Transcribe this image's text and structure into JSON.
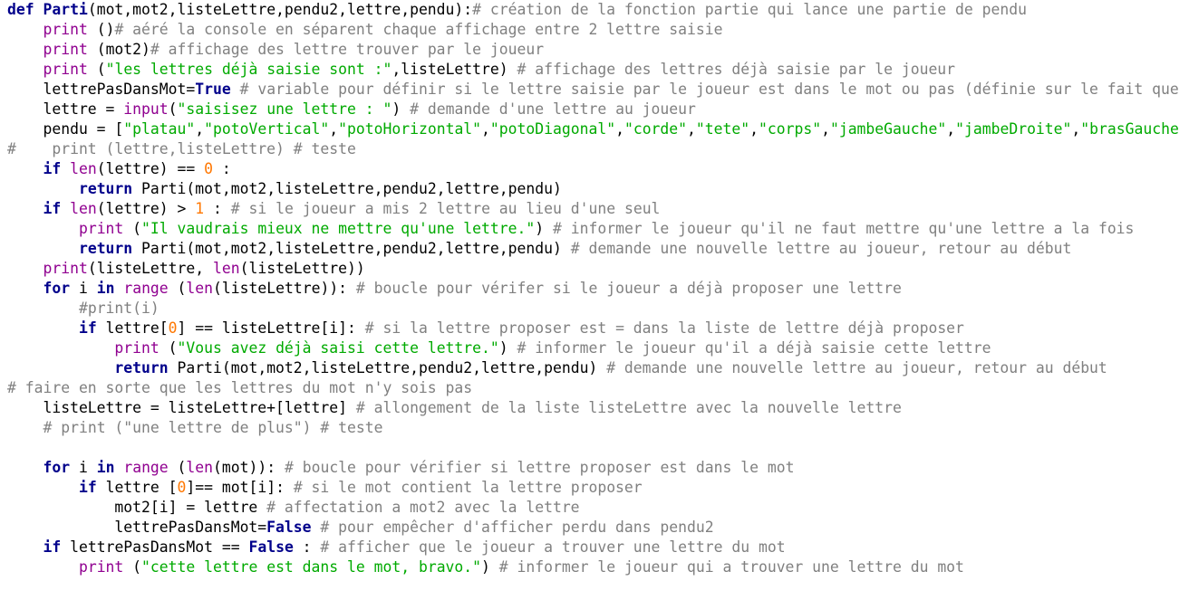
{
  "editor": {
    "language": "python",
    "colors": {
      "background": "#ffffff",
      "keyword": "#00008b",
      "builtin": "#900090",
      "string": "#00aa00",
      "number": "#ff7700",
      "comment": "#808080",
      "text": "#000000"
    },
    "lines": [
      [
        [
          "kw",
          "def "
        ],
        [
          "fn",
          "Parti"
        ],
        [
          "tx",
          "(mot,mot2,listeLettre,pendu2,lettre,pendu):"
        ],
        [
          "cm",
          "# création de la fonction partie qui lance une partie de pendu"
        ]
      ],
      [
        [
          "tx",
          "    "
        ],
        [
          "bi",
          "print"
        ],
        [
          "tx",
          " ()"
        ],
        [
          "cm",
          "# aéré la console en séparent chaque affichage entre 2 lettre saisie"
        ]
      ],
      [
        [
          "tx",
          "    "
        ],
        [
          "bi",
          "print"
        ],
        [
          "tx",
          " (mot2)"
        ],
        [
          "cm",
          "# affichage des lettre trouver par le joueur"
        ]
      ],
      [
        [
          "tx",
          "    "
        ],
        [
          "bi",
          "print"
        ],
        [
          "tx",
          " ("
        ],
        [
          "st",
          "\"les lettres déjà saisie sont :\""
        ],
        [
          "tx",
          ",listeLettre) "
        ],
        [
          "cm",
          "# affichage des lettres déjà saisie par le joueur"
        ]
      ],
      [
        [
          "tx",
          "    lettrePasDansMot="
        ],
        [
          "kw",
          "True"
        ],
        [
          "tx",
          " "
        ],
        [
          "cm",
          "# variable pour définir si le lettre saisie par le joueur est dans le mot ou pas (définie sur le fait que"
        ]
      ],
      [
        [
          "tx",
          "    lettre = "
        ],
        [
          "bi",
          "input"
        ],
        [
          "tx",
          "("
        ],
        [
          "st",
          "\"saisisez une lettre : \""
        ],
        [
          "tx",
          ") "
        ],
        [
          "cm",
          "# demande d'une lettre au joueur"
        ]
      ],
      [
        [
          "tx",
          "    pendu = ["
        ],
        [
          "st",
          "\"platau\""
        ],
        [
          "tx",
          ","
        ],
        [
          "st",
          "\"potoVertical\""
        ],
        [
          "tx",
          ","
        ],
        [
          "st",
          "\"potoHorizontal\""
        ],
        [
          "tx",
          ","
        ],
        [
          "st",
          "\"potoDiagonal\""
        ],
        [
          "tx",
          ","
        ],
        [
          "st",
          "\"corde\""
        ],
        [
          "tx",
          ","
        ],
        [
          "st",
          "\"tete\""
        ],
        [
          "tx",
          ","
        ],
        [
          "st",
          "\"corps\""
        ],
        [
          "tx",
          ","
        ],
        [
          "st",
          "\"jambeGauche\""
        ],
        [
          "tx",
          ","
        ],
        [
          "st",
          "\"jambeDroite\""
        ],
        [
          "tx",
          ","
        ],
        [
          "st",
          "\"brasGauche"
        ]
      ],
      [
        [
          "cm",
          "#    print (lettre,listeLettre) # teste"
        ]
      ],
      [
        [
          "tx",
          "    "
        ],
        [
          "kw",
          "if"
        ],
        [
          "tx",
          " "
        ],
        [
          "bi",
          "len"
        ],
        [
          "tx",
          "(lettre) == "
        ],
        [
          "nm",
          "0"
        ],
        [
          "tx",
          " :"
        ]
      ],
      [
        [
          "tx",
          "        "
        ],
        [
          "kw",
          "return"
        ],
        [
          "tx",
          " Parti(mot,mot2,listeLettre,pendu2,lettre,pendu)"
        ]
      ],
      [
        [
          "tx",
          "    "
        ],
        [
          "kw",
          "if"
        ],
        [
          "tx",
          " "
        ],
        [
          "bi",
          "len"
        ],
        [
          "tx",
          "(lettre) > "
        ],
        [
          "nm",
          "1"
        ],
        [
          "tx",
          " : "
        ],
        [
          "cm",
          "# si le joueur a mis 2 lettre au lieu d'une seul"
        ]
      ],
      [
        [
          "tx",
          "        "
        ],
        [
          "bi",
          "print"
        ],
        [
          "tx",
          " ("
        ],
        [
          "st",
          "\"Il vaudrais mieux ne mettre qu'une lettre.\""
        ],
        [
          "tx",
          ") "
        ],
        [
          "cm",
          "# informer le joueur qu'il ne faut mettre qu'une lettre a la fois"
        ]
      ],
      [
        [
          "tx",
          "        "
        ],
        [
          "kw",
          "return"
        ],
        [
          "tx",
          " Parti(mot,mot2,listeLettre,pendu2,lettre,pendu) "
        ],
        [
          "cm",
          "# demande une nouvelle lettre au joueur, retour au début"
        ]
      ],
      [
        [
          "tx",
          "    "
        ],
        [
          "bi",
          "print"
        ],
        [
          "tx",
          "(listeLettre, "
        ],
        [
          "bi",
          "len"
        ],
        [
          "tx",
          "(listeLettre))"
        ]
      ],
      [
        [
          "tx",
          "    "
        ],
        [
          "kw",
          "for"
        ],
        [
          "tx",
          " i "
        ],
        [
          "kw",
          "in"
        ],
        [
          "tx",
          " "
        ],
        [
          "bi",
          "range"
        ],
        [
          "tx",
          " ("
        ],
        [
          "bi",
          "len"
        ],
        [
          "tx",
          "(listeLettre)): "
        ],
        [
          "cm",
          "# boucle pour vérifer si le joueur a déjà proposer une lettre"
        ]
      ],
      [
        [
          "tx",
          "        "
        ],
        [
          "cm",
          "#print(i)"
        ]
      ],
      [
        [
          "tx",
          "        "
        ],
        [
          "kw",
          "if"
        ],
        [
          "tx",
          " lettre["
        ],
        [
          "nm",
          "0"
        ],
        [
          "tx",
          "] == listeLettre[i]: "
        ],
        [
          "cm",
          "# si la lettre proposer est = dans la liste de lettre déjà proposer"
        ]
      ],
      [
        [
          "tx",
          "            "
        ],
        [
          "bi",
          "print"
        ],
        [
          "tx",
          " ("
        ],
        [
          "st",
          "\"Vous avez déjà saisi cette lettre.\""
        ],
        [
          "tx",
          ") "
        ],
        [
          "cm",
          "# informer le joueur qu'il a déjà saisie cette lettre"
        ]
      ],
      [
        [
          "tx",
          "            "
        ],
        [
          "kw",
          "return"
        ],
        [
          "tx",
          " Parti(mot,mot2,listeLettre,pendu2,lettre,pendu) "
        ],
        [
          "cm",
          "# demande une nouvelle lettre au joueur, retour au début"
        ]
      ],
      [
        [
          "cm",
          "# faire en sorte que les lettres du mot n'y sois pas"
        ]
      ],
      [
        [
          "tx",
          "    listeLettre = listeLettre+[lettre] "
        ],
        [
          "cm",
          "# allongement de la liste listeLettre avec la nouvelle lettre"
        ]
      ],
      [
        [
          "tx",
          "    "
        ],
        [
          "cm",
          "# print (\"une lettre de plus\") # teste"
        ]
      ],
      [
        [
          "tx",
          ""
        ]
      ],
      [
        [
          "tx",
          "    "
        ],
        [
          "kw",
          "for"
        ],
        [
          "tx",
          " i "
        ],
        [
          "kw",
          "in"
        ],
        [
          "tx",
          " "
        ],
        [
          "bi",
          "range"
        ],
        [
          "tx",
          " ("
        ],
        [
          "bi",
          "len"
        ],
        [
          "tx",
          "(mot)): "
        ],
        [
          "cm",
          "# boucle pour vérifier si lettre proposer est dans le mot"
        ]
      ],
      [
        [
          "tx",
          "        "
        ],
        [
          "kw",
          "if"
        ],
        [
          "tx",
          " lettre ["
        ],
        [
          "nm",
          "0"
        ],
        [
          "tx",
          "]== mot[i]: "
        ],
        [
          "cm",
          "# si le mot contient la lettre proposer"
        ]
      ],
      [
        [
          "tx",
          "            mot2[i] = lettre "
        ],
        [
          "cm",
          "# affectation a mot2 avec la lettre"
        ]
      ],
      [
        [
          "tx",
          "            lettrePasDansMot="
        ],
        [
          "kw",
          "False"
        ],
        [
          "tx",
          " "
        ],
        [
          "cm",
          "# pour empêcher d'afficher perdu dans pendu2"
        ]
      ],
      [
        [
          "tx",
          "    "
        ],
        [
          "kw",
          "if"
        ],
        [
          "tx",
          " lettrePasDansMot == "
        ],
        [
          "kw",
          "False"
        ],
        [
          "tx",
          " : "
        ],
        [
          "cm",
          "# afficher que le joueur a trouver une lettre du mot"
        ]
      ],
      [
        [
          "tx",
          "        "
        ],
        [
          "bi",
          "print"
        ],
        [
          "tx",
          " ("
        ],
        [
          "st",
          "\"cette lettre est dans le mot, bravo.\""
        ],
        [
          "tx",
          ") "
        ],
        [
          "cm",
          "# informer le joueur qui a trouver une lettre du mot"
        ]
      ]
    ]
  }
}
